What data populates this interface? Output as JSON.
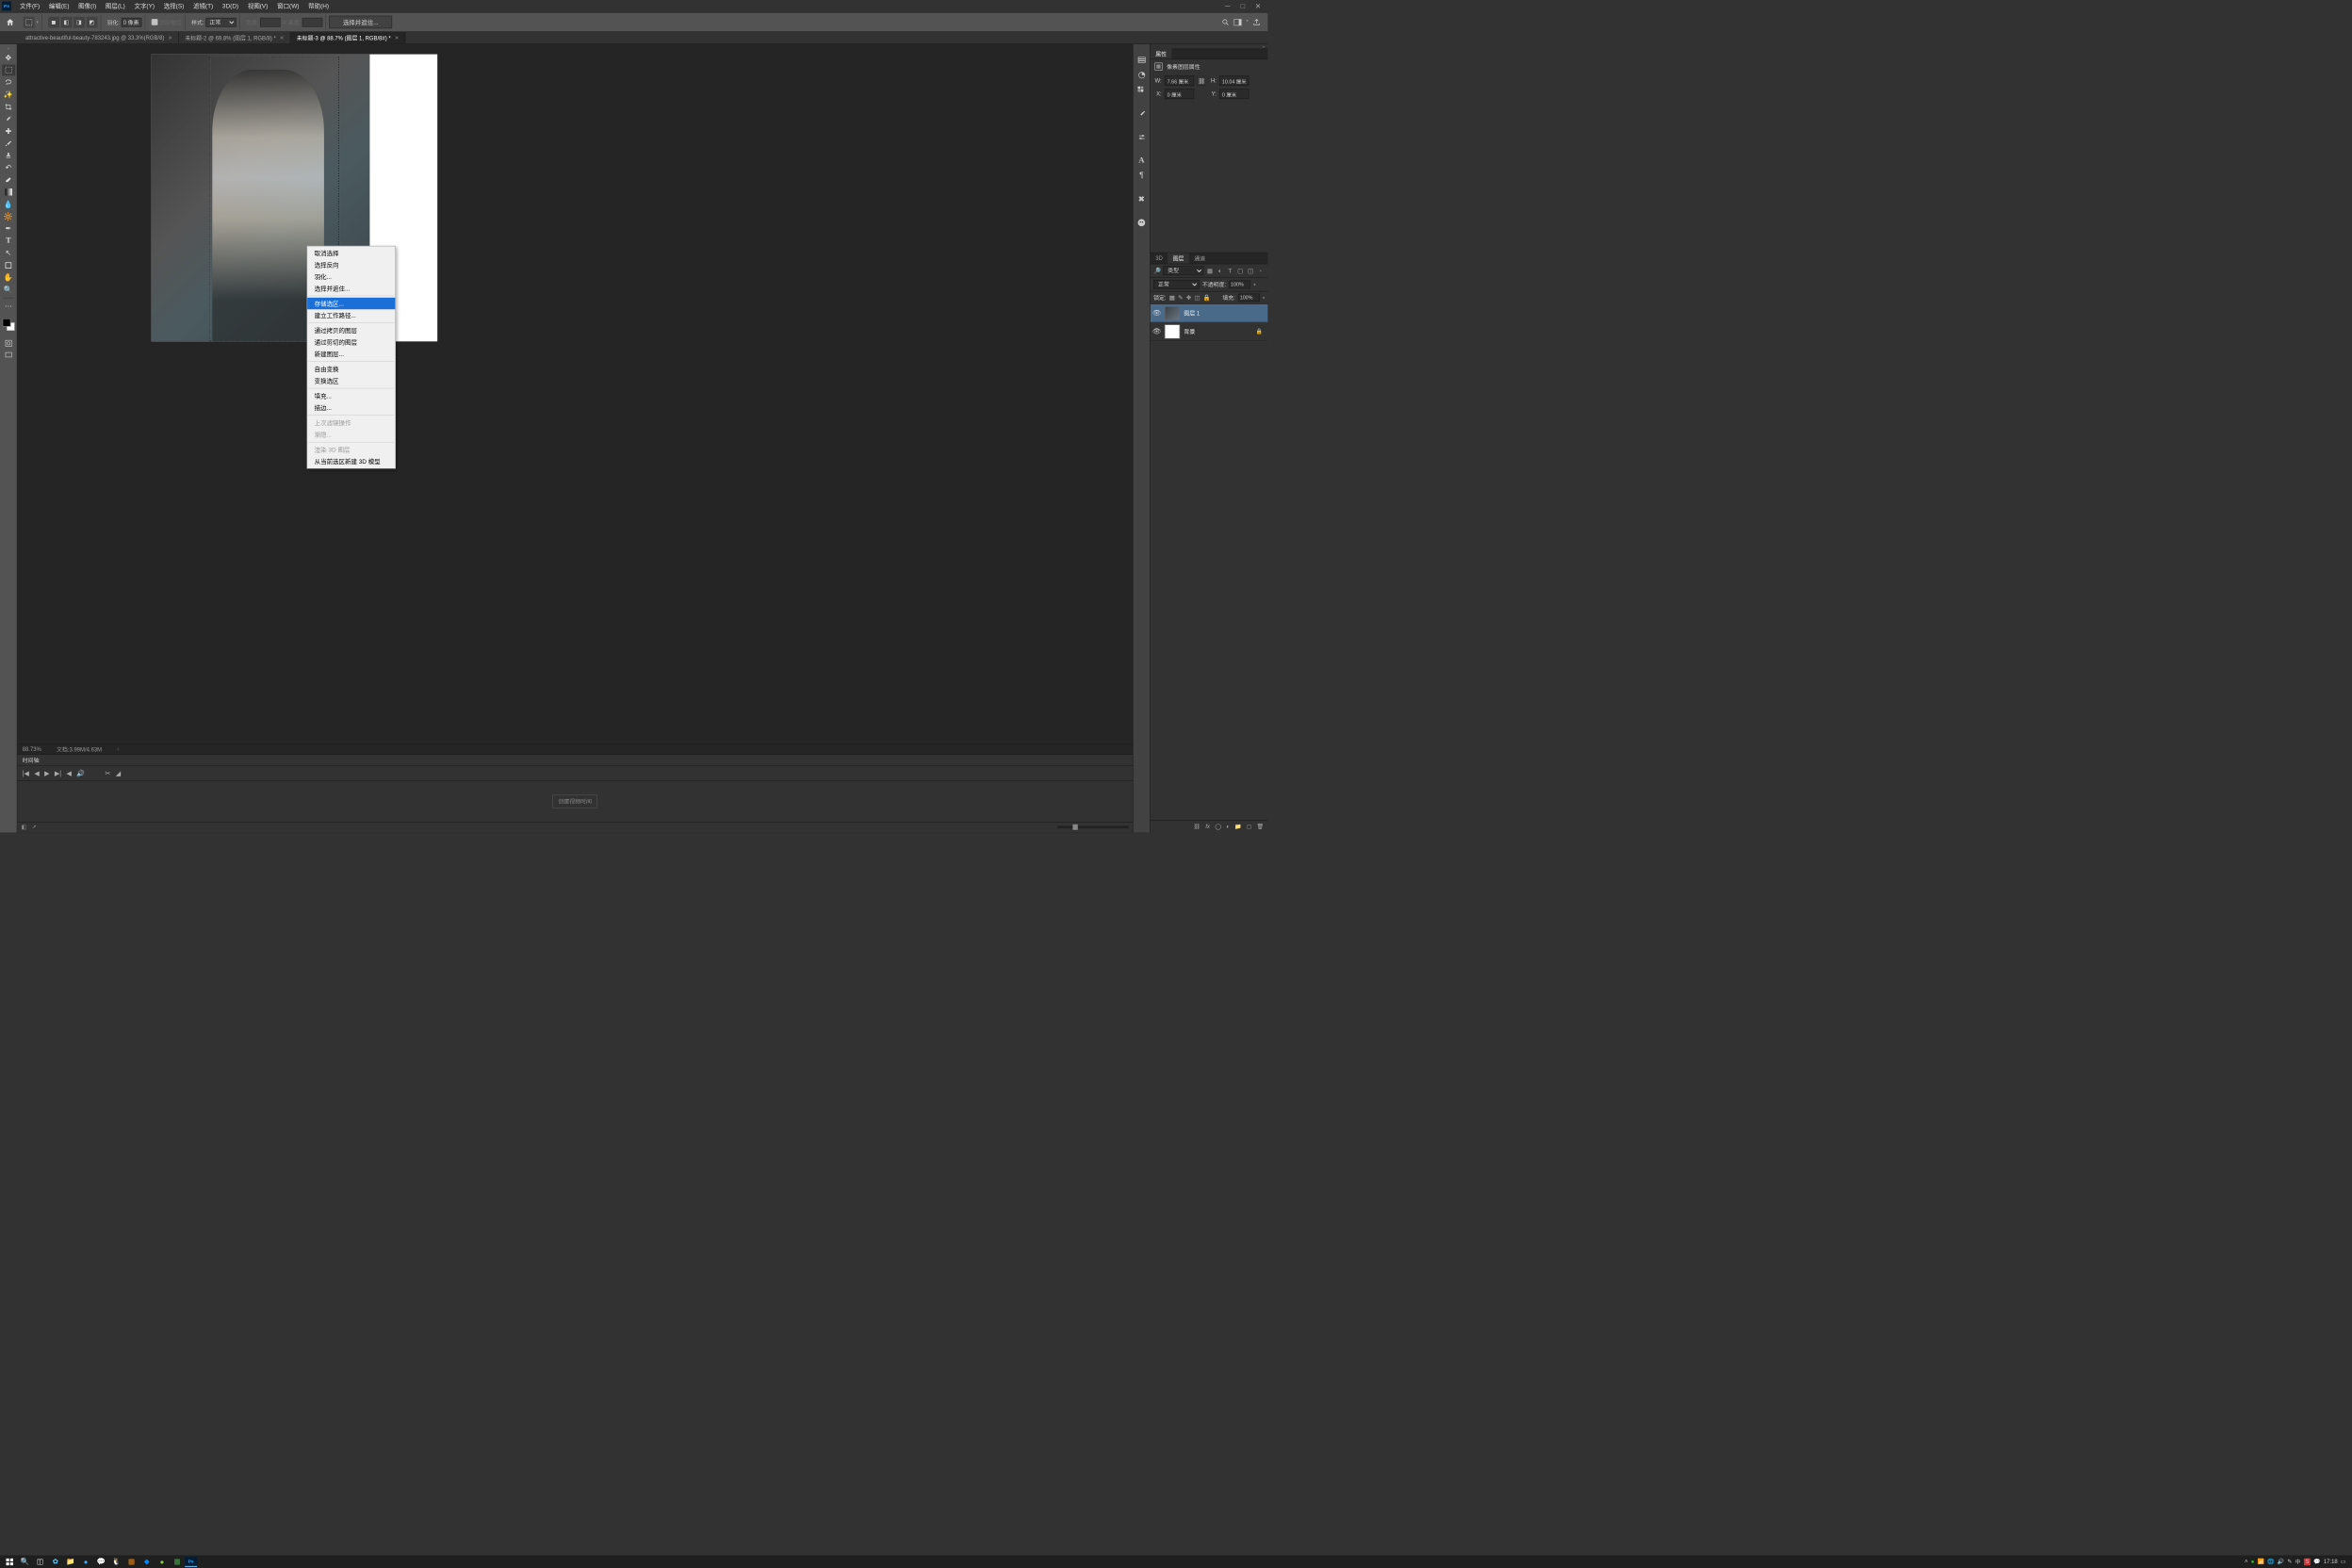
{
  "menubar": {
    "items": [
      "文件(F)",
      "编辑(E)",
      "图像(I)",
      "图层(L)",
      "文字(Y)",
      "选择(S)",
      "滤镜(T)",
      "3D(D)",
      "视图(V)",
      "窗口(W)",
      "帮助(H)"
    ]
  },
  "optionsbar": {
    "feather_label": "羽化:",
    "feather_value": "0 像素",
    "antialias": "消除锯齿",
    "style_label": "样式:",
    "style_value": "正常",
    "width_label": "宽度:",
    "height_label": "高度:",
    "select_mask": "选择并遮住..."
  },
  "doc_tabs": [
    {
      "title": "attractive-beautiful-beauty-783243.jpg @ 33.3%(RGB/8)",
      "active": false
    },
    {
      "title": "未标题-2 @ 69.8% (图层 1, RGB/8) *",
      "active": false
    },
    {
      "title": "未标题-3 @ 88.7% (图层 1, RGB/8#) *",
      "active": true
    }
  ],
  "status": {
    "zoom": "88.73%",
    "doc_size": "文档:3.99M/4.63M"
  },
  "timeline": {
    "tab": "时间轴",
    "create_btn": "创建视频时间"
  },
  "context_menu": {
    "items": [
      {
        "label": "取消选择",
        "type": "item"
      },
      {
        "label": "选择反向",
        "type": "item"
      },
      {
        "label": "羽化...",
        "type": "item"
      },
      {
        "label": "选择并遮住...",
        "type": "item"
      },
      {
        "type": "sep"
      },
      {
        "label": "存储选区...",
        "type": "item",
        "highlighted": true
      },
      {
        "label": "建立工作路径...",
        "type": "item"
      },
      {
        "type": "sep"
      },
      {
        "label": "通过拷贝的图层",
        "type": "item"
      },
      {
        "label": "通过剪切的图层",
        "type": "item"
      },
      {
        "label": "新建图层...",
        "type": "item"
      },
      {
        "type": "sep"
      },
      {
        "label": "自由变换",
        "type": "item"
      },
      {
        "label": "变换选区",
        "type": "item"
      },
      {
        "type": "sep"
      },
      {
        "label": "填充...",
        "type": "item"
      },
      {
        "label": "描边...",
        "type": "item"
      },
      {
        "type": "sep"
      },
      {
        "label": "上次滤镜操作",
        "type": "item",
        "disabled": true
      },
      {
        "label": "渐隐...",
        "type": "item",
        "disabled": true
      },
      {
        "type": "sep"
      },
      {
        "label": "渲染 3D 图层",
        "type": "item",
        "disabled": true
      },
      {
        "label": "从当前选区新建 3D 模型",
        "type": "item"
      }
    ]
  },
  "properties": {
    "tab": "属性",
    "title": "像素图层属性",
    "w_label": "W:",
    "w_value": "7.66 厘米",
    "h_label": "H:",
    "h_value": "10.04 厘米",
    "x_label": "X:",
    "x_value": "0 厘米",
    "y_label": "Y:",
    "y_value": "0 厘米"
  },
  "layers_panel": {
    "tabs": [
      "3D",
      "图层",
      "通道"
    ],
    "active_tab": "图层",
    "kind_label": "类型",
    "blend_mode": "正常",
    "opacity_label": "不透明度:",
    "opacity_value": "100%",
    "lock_label": "锁定:",
    "fill_label": "填充:",
    "fill_value": "100%",
    "layers": [
      {
        "name": "图层 1",
        "selected": true,
        "visible": true,
        "locked": false,
        "thumb": "img"
      },
      {
        "name": "背景",
        "selected": false,
        "visible": true,
        "locked": true,
        "thumb": "white"
      }
    ]
  },
  "taskbar": {
    "time": "17:18",
    "ime": "中"
  }
}
